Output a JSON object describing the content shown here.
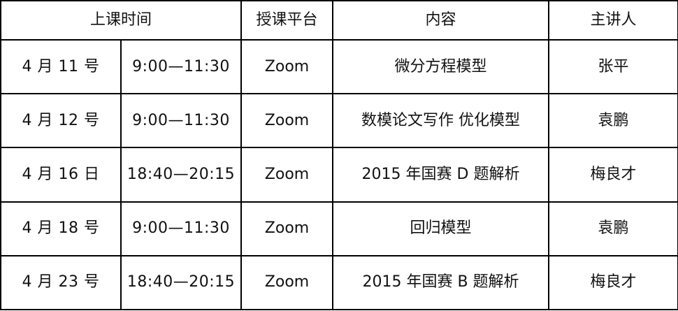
{
  "headers": {
    "time": "上课时间",
    "platform": "授课平台",
    "content": "内容",
    "speaker": "主讲人"
  },
  "rows": [
    {
      "date": "4 月 11 号",
      "time": "9:00—11:30",
      "platform": "Zoom",
      "content": "微分方程模型",
      "speaker": "张平"
    },
    {
      "date": "4 月 12 号",
      "time": "9:00—11:30",
      "platform": "Zoom",
      "content": "数模论文写作 优化模型",
      "speaker": "袁鹏"
    },
    {
      "date": "4 月 16 日",
      "time": "18:40—20:15",
      "platform": "Zoom",
      "content": "2015 年国赛 D 题解析",
      "speaker": "梅良才"
    },
    {
      "date": "4 月 18 号",
      "time": "9:00—11:30",
      "platform": "Zoom",
      "content": "回归模型",
      "speaker": "袁鹏"
    },
    {
      "date": "4 月 23 号",
      "time": "18:40—20:15",
      "platform": "Zoom",
      "content": "2015 年国赛 B 题解析",
      "speaker": "梅良才"
    }
  ]
}
